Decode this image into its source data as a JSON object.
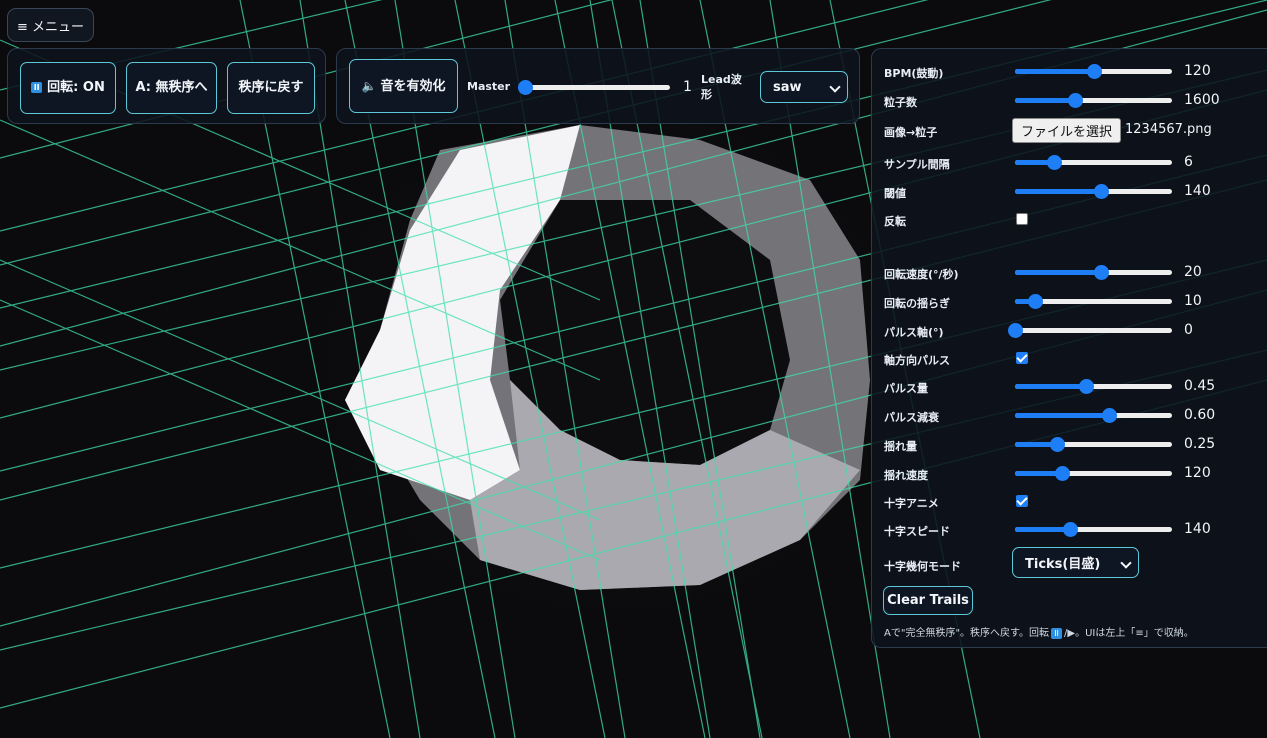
{
  "menu": {
    "label": "≡ メニュー"
  },
  "toolbar_left": {
    "rotate_icon": "pause-icon",
    "rotate_label": "回転: ON",
    "disorder_label": "A: 無秩序へ",
    "restore_label": "秩序に戻す"
  },
  "toolbar_audio": {
    "enable_label": "音を有効化",
    "speaker_icon": "speaker-icon",
    "master_label": "Master",
    "master_value": "1",
    "master_fraction": 0,
    "lead_label": "Lead波形",
    "lead_selected": "saw"
  },
  "settings": {
    "bpm": {
      "label": "BPM(鼓動)",
      "value": "120",
      "fraction": 0.5
    },
    "particles": {
      "label": "粒子数",
      "value": "1600",
      "fraction": 0.38
    },
    "image": {
      "label": "画像→粒子",
      "button": "ファイルを選択",
      "file": "1234567.png"
    },
    "sample": {
      "label": "サンプル間隔",
      "value": "6",
      "fraction": 0.25
    },
    "threshold": {
      "label": "閾値",
      "value": "140",
      "fraction": 0.55
    },
    "invert": {
      "label": "反転",
      "checked": false
    },
    "rot_speed": {
      "label": "回転速度(°/秒)",
      "value": "20",
      "fraction": 0.55
    },
    "rot_wobble": {
      "label": "回転の揺らぎ",
      "value": "10",
      "fraction": 0.13
    },
    "pulse_axis": {
      "label": "パルス軸(°)",
      "value": "0",
      "fraction": 0.0
    },
    "axial_pulse": {
      "label": "軸方向パルス",
      "checked": true
    },
    "pulse_amount": {
      "label": "パルス量",
      "value": "0.45",
      "fraction": 0.45
    },
    "pulse_decay": {
      "label": "パルス減衰",
      "value": "0.60",
      "fraction": 0.6
    },
    "shake_amount": {
      "label": "揺れ量",
      "value": "0.25",
      "fraction": 0.27
    },
    "shake_speed": {
      "label": "揺れ速度",
      "value": "120",
      "fraction": 0.3
    },
    "cross_anim": {
      "label": "十字アニメ",
      "checked": true
    },
    "cross_speed": {
      "label": "十字スピード",
      "value": "140",
      "fraction": 0.35
    },
    "cross_mode": {
      "label": "十字幾何モード",
      "selected": "Ticks(目盛)"
    },
    "clear_trails": "Clear Trails",
    "hint_pre": "Aで\"完全無秩序\"。秩序へ戻す。回転",
    "hint_post": "/▶。UIは左上「≡」で収納。"
  },
  "colors": {
    "accent": "#1e7ef5",
    "button_border": "#5ec8d8",
    "grid": "#3fe0a8"
  }
}
